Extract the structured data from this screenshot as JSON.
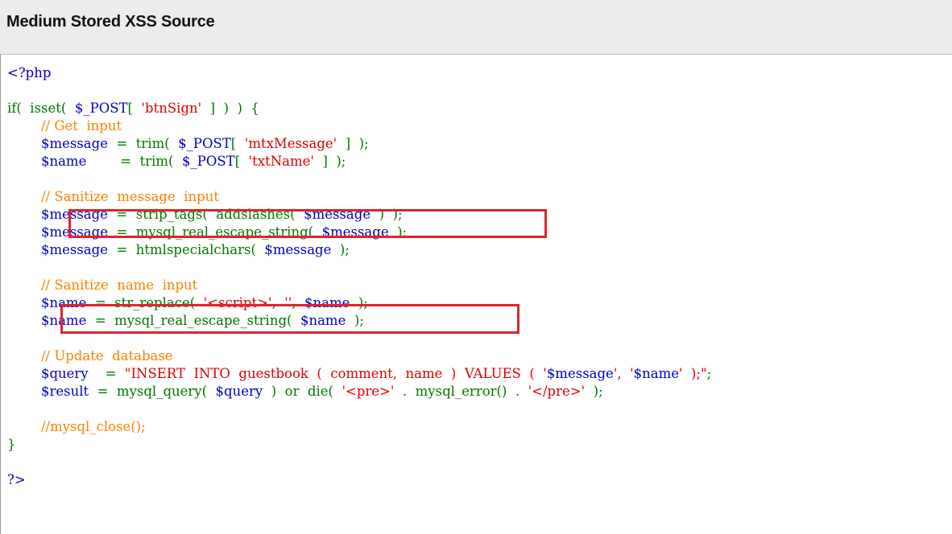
{
  "header": {
    "title": "Medium Stored XSS Source"
  },
  "code": {
    "lines": [
      [
        {
          "t": "<?php",
          "c": "var"
        }
      ],
      [],
      [
        {
          "t": "if(  isset(  ",
          "c": "kw"
        },
        {
          "t": "$_POST",
          "c": "var"
        },
        {
          "t": "[  ",
          "c": "kw"
        },
        {
          "t": "'btnSign'",
          "c": "str"
        },
        {
          "t": "  ]  )  )  {",
          "c": "kw"
        }
      ],
      [
        {
          "t": "        // Get  input",
          "c": "cm"
        }
      ],
      [
        {
          "t": "        $message",
          "c": "var"
        },
        {
          "t": "  =  trim(  ",
          "c": "kw"
        },
        {
          "t": "$_POST",
          "c": "var"
        },
        {
          "t": "[  ",
          "c": "kw"
        },
        {
          "t": "'mtxMessage'",
          "c": "str"
        },
        {
          "t": "  ]  );",
          "c": "kw"
        }
      ],
      [
        {
          "t": "        $name",
          "c": "var"
        },
        {
          "t": "        =  trim(  ",
          "c": "kw"
        },
        {
          "t": "$_POST",
          "c": "var"
        },
        {
          "t": "[  ",
          "c": "kw"
        },
        {
          "t": "'txtName'",
          "c": "str"
        },
        {
          "t": "  ]  );",
          "c": "kw"
        }
      ],
      [],
      [
        {
          "t": "        // Sanitize  message  input",
          "c": "cm"
        }
      ],
      [
        {
          "t": "        $message",
          "c": "var"
        },
        {
          "t": "  =  strip_tags(  addslashes(  ",
          "c": "kw"
        },
        {
          "t": "$message",
          "c": "var"
        },
        {
          "t": "  )  );",
          "c": "kw"
        }
      ],
      [
        {
          "t": "        $message",
          "c": "var"
        },
        {
          "t": "  =  mysql_real_escape_string(  ",
          "c": "kw"
        },
        {
          "t": "$message",
          "c": "var"
        },
        {
          "t": "  );",
          "c": "kw"
        }
      ],
      [
        {
          "t": "        $message",
          "c": "var"
        },
        {
          "t": "  =  htmlspecialchars(  ",
          "c": "kw"
        },
        {
          "t": "$message",
          "c": "var"
        },
        {
          "t": "  );",
          "c": "kw"
        }
      ],
      [],
      [
        {
          "t": "        // Sanitize  name  input",
          "c": "cm"
        }
      ],
      [
        {
          "t": "        $name",
          "c": "var"
        },
        {
          "t": "  =  str_replace(  ",
          "c": "kw"
        },
        {
          "t": "'<script>'",
          "c": "str"
        },
        {
          "t": ",  ",
          "c": "kw"
        },
        {
          "t": "''",
          "c": "str"
        },
        {
          "t": ",  ",
          "c": "kw"
        },
        {
          "t": "$name",
          "c": "var"
        },
        {
          "t": "  );",
          "c": "kw"
        }
      ],
      [
        {
          "t": "        $name",
          "c": "var"
        },
        {
          "t": "  =  mysql_real_escape_string(  ",
          "c": "kw"
        },
        {
          "t": "$name",
          "c": "var"
        },
        {
          "t": "  );",
          "c": "kw"
        }
      ],
      [],
      [
        {
          "t": "        // Update  database",
          "c": "cm"
        }
      ],
      [
        {
          "t": "        $query",
          "c": "var"
        },
        {
          "t": "    =  ",
          "c": "kw"
        },
        {
          "t": "\"INSERT  INTO  guestbook  (  comment,  name  )  VALUES  (  '",
          "c": "str"
        },
        {
          "t": "$message",
          "c": "var"
        },
        {
          "t": "',  '",
          "c": "str"
        },
        {
          "t": "$name",
          "c": "var"
        },
        {
          "t": "'  );\"",
          "c": "str"
        },
        {
          "t": ";",
          "c": "kw"
        }
      ],
      [
        {
          "t": "        $result",
          "c": "var"
        },
        {
          "t": "  =  mysql_query(  ",
          "c": "kw"
        },
        {
          "t": "$query",
          "c": "var"
        },
        {
          "t": "  )  or  die(  ",
          "c": "kw"
        },
        {
          "t": "'<pre>'",
          "c": "str"
        },
        {
          "t": "  .  mysql_error()  .  ",
          "c": "kw"
        },
        {
          "t": "'</pre>'",
          "c": "str"
        },
        {
          "t": "  );",
          "c": "kw"
        }
      ],
      [],
      [
        {
          "t": "        //mysql_close();",
          "c": "cm"
        }
      ],
      [
        {
          "t": "}",
          "c": "kw"
        }
      ],
      [],
      [
        {
          "t": "?>",
          "c": "var"
        }
      ]
    ]
  }
}
